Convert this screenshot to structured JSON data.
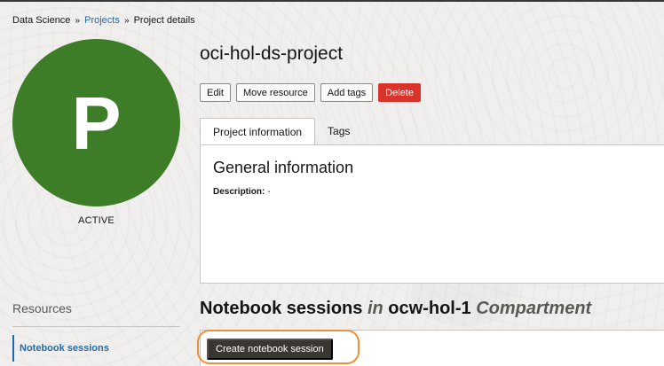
{
  "breadcrumb": {
    "root": "Data Science",
    "parent": "Projects",
    "current": "Project details",
    "separator": "»"
  },
  "project": {
    "avatar_letter": "P",
    "status": "ACTIVE",
    "title": "oci-hol-ds-project"
  },
  "actions": {
    "edit": "Edit",
    "move": "Move resource",
    "add_tags": "Add tags",
    "delete": "Delete"
  },
  "tabs": {
    "project_information": "Project information",
    "tags": "Tags"
  },
  "general": {
    "heading": "General information",
    "description_label": "Description:",
    "description_value": "-"
  },
  "resources": {
    "heading": "Resources",
    "notebook_sessions": "Notebook sessions"
  },
  "notebooks": {
    "title_prefix": "Notebook sessions",
    "title_in": "in",
    "compartment_name": "ocw-hol-1",
    "compartment_word": "Compartment",
    "create_button": "Create notebook session"
  },
  "colors": {
    "avatar": "#3d7d28",
    "delete_button": "#d9332b",
    "link": "#1f6aa5",
    "highlight": "#e8923a",
    "primary_button": "#3a3632"
  }
}
